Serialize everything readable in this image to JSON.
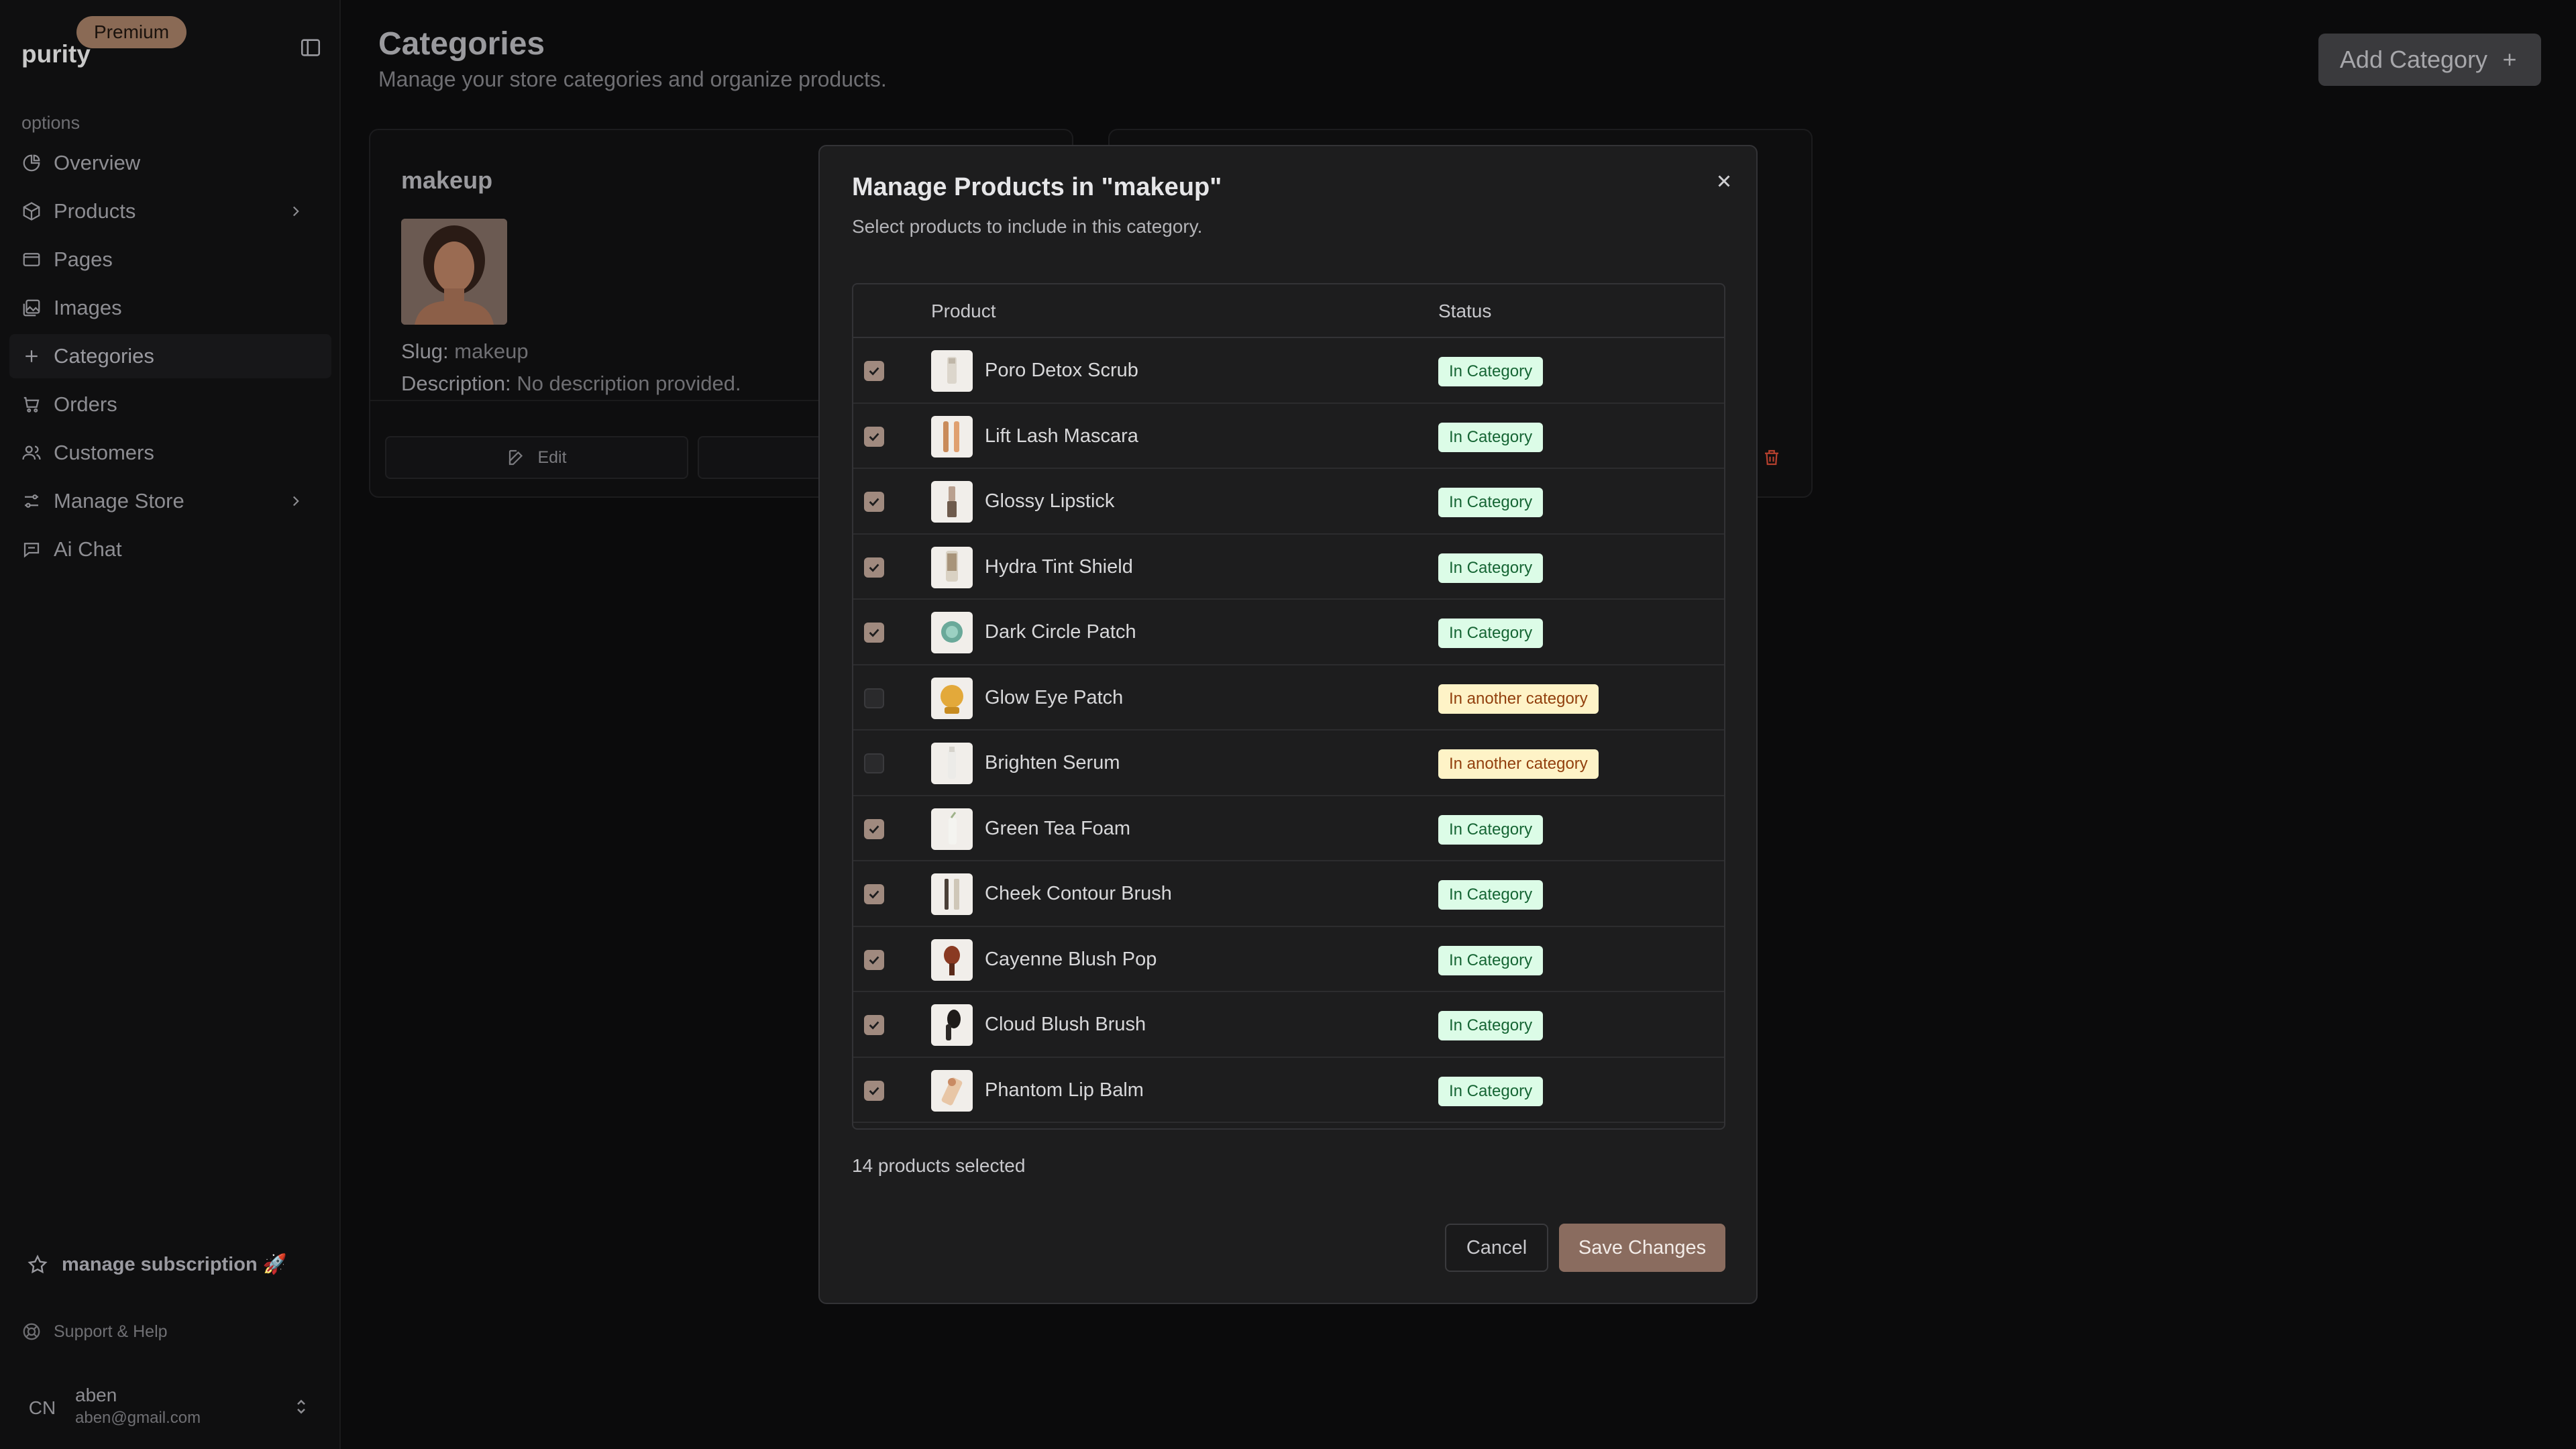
{
  "sidebar": {
    "brand": "purity",
    "badge": "Premium",
    "section_label": "options",
    "items": [
      {
        "label": "Overview",
        "icon": "pie-chart-icon"
      },
      {
        "label": "Products",
        "icon": "box-icon"
      },
      {
        "label": "Pages",
        "icon": "window-icon"
      },
      {
        "label": "Images",
        "icon": "images-icon"
      },
      {
        "label": "Categories",
        "icon": "plus-icon"
      },
      {
        "label": "Orders",
        "icon": "cart-icon"
      },
      {
        "label": "Customers",
        "icon": "users-icon"
      },
      {
        "label": "Manage Store",
        "icon": "sliders-icon"
      },
      {
        "label": "Ai Chat",
        "icon": "chat-icon"
      }
    ],
    "subscription": "manage subscription 🚀",
    "support": "Support & Help",
    "user": {
      "initials": "CN",
      "name": "aben",
      "email": "aben@gmail.com"
    }
  },
  "header": {
    "title": "Categories",
    "subtitle": "Manage your store categories and organize products.",
    "add_button": "Add Category"
  },
  "card": {
    "title": "makeup",
    "slug_label": "Slug:",
    "slug": "makeup",
    "description_label": "Description:",
    "description": "No description provided.",
    "edit_label": "Edit"
  },
  "modal": {
    "title": "Manage Products in \"makeup\"",
    "subtitle": "Select products to include in this category.",
    "columns": {
      "product": "Product",
      "status": "Status"
    },
    "products": [
      {
        "name": "Poro Detox Scrub",
        "status": "In Category",
        "checked": true
      },
      {
        "name": "Lift Lash Mascara",
        "status": "In Category",
        "checked": true
      },
      {
        "name": "Glossy Lipstick",
        "status": "In Category",
        "checked": true
      },
      {
        "name": "Hydra Tint Shield",
        "status": "In Category",
        "checked": true
      },
      {
        "name": "Dark Circle Patch",
        "status": "In Category",
        "checked": true
      },
      {
        "name": "Glow Eye Patch",
        "status": "In another category",
        "checked": false
      },
      {
        "name": "Brighten Serum",
        "status": "In another category",
        "checked": false
      },
      {
        "name": "Green Tea Foam",
        "status": "In Category",
        "checked": true
      },
      {
        "name": "Cheek Contour Brush",
        "status": "In Category",
        "checked": true
      },
      {
        "name": "Cayenne Blush Pop",
        "status": "In Category",
        "checked": true
      },
      {
        "name": "Cloud Blush Brush",
        "status": "In Category",
        "checked": true
      },
      {
        "name": "Phantom Lip Balm",
        "status": "In Category",
        "checked": true
      }
    ],
    "selected_count": "14 products selected",
    "cancel": "Cancel",
    "save": "Save Changes"
  },
  "colors": {
    "accent": "#8a6c5f",
    "badge_in_bg": "#dcfce7",
    "badge_in_text": "#166534",
    "badge_other_bg": "#fef3c7",
    "badge_other_text": "#92400e"
  }
}
